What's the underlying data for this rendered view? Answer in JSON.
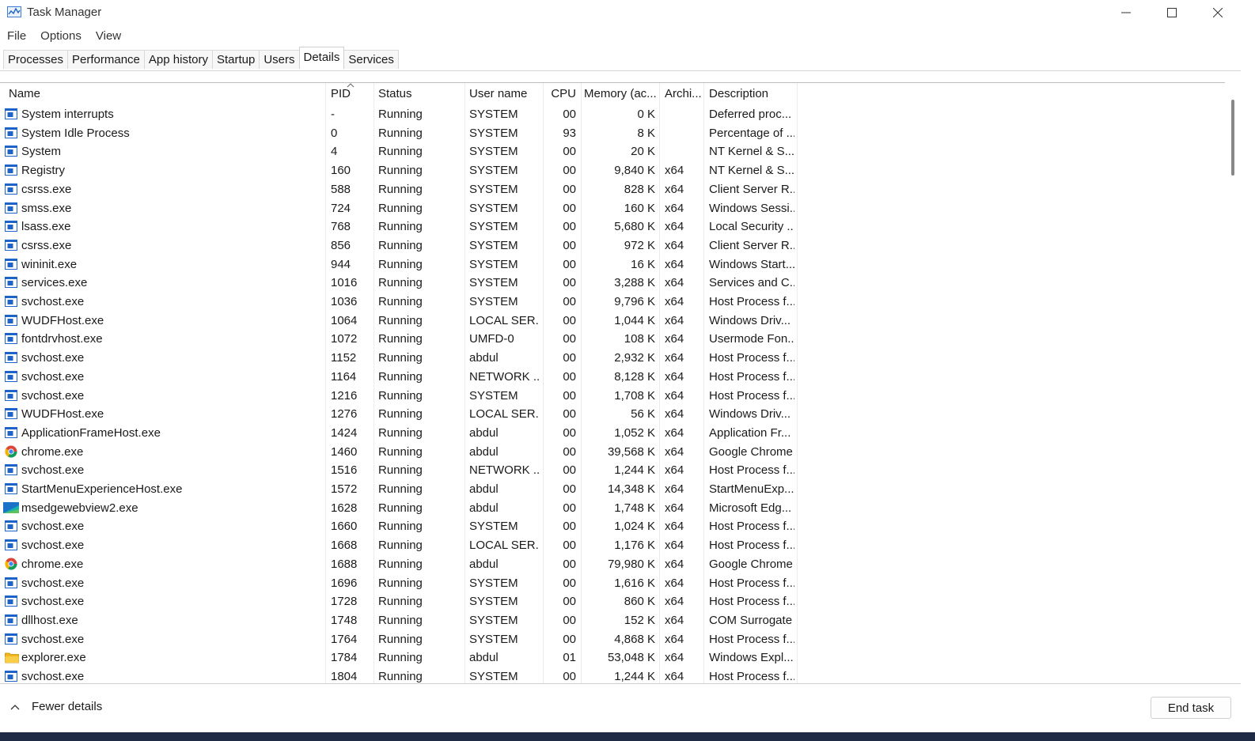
{
  "window": {
    "title": "Task Manager"
  },
  "menu": [
    "File",
    "Options",
    "View"
  ],
  "tabs": [
    {
      "label": "Processes",
      "active": false
    },
    {
      "label": "Performance",
      "active": false
    },
    {
      "label": "App history",
      "active": false
    },
    {
      "label": "Startup",
      "active": false
    },
    {
      "label": "Users",
      "active": false
    },
    {
      "label": "Details",
      "active": true
    },
    {
      "label": "Services",
      "active": false
    }
  ],
  "table": {
    "columns": [
      "Name",
      "PID",
      "Status",
      "User name",
      "CPU",
      "Memory (ac...",
      "Archi...",
      "Description"
    ],
    "sorted_column": "PID",
    "rows": [
      {
        "icon": "window",
        "name": "System interrupts",
        "pid": "-",
        "status": "Running",
        "user": "SYSTEM",
        "cpu": "00",
        "memory": "0 K",
        "arch": "",
        "desc": "Deferred proc..."
      },
      {
        "icon": "window",
        "name": "System Idle Process",
        "pid": "0",
        "status": "Running",
        "user": "SYSTEM",
        "cpu": "93",
        "memory": "8 K",
        "arch": "",
        "desc": "Percentage of ..."
      },
      {
        "icon": "window",
        "name": "System",
        "pid": "4",
        "status": "Running",
        "user": "SYSTEM",
        "cpu": "00",
        "memory": "20 K",
        "arch": "",
        "desc": "NT Kernel & S..."
      },
      {
        "icon": "window",
        "name": "Registry",
        "pid": "160",
        "status": "Running",
        "user": "SYSTEM",
        "cpu": "00",
        "memory": "9,840 K",
        "arch": "x64",
        "desc": "NT Kernel & S..."
      },
      {
        "icon": "window",
        "name": "csrss.exe",
        "pid": "588",
        "status": "Running",
        "user": "SYSTEM",
        "cpu": "00",
        "memory": "828 K",
        "arch": "x64",
        "desc": "Client Server R..."
      },
      {
        "icon": "window",
        "name": "smss.exe",
        "pid": "724",
        "status": "Running",
        "user": "SYSTEM",
        "cpu": "00",
        "memory": "160 K",
        "arch": "x64",
        "desc": "Windows Sessi..."
      },
      {
        "icon": "window",
        "name": "lsass.exe",
        "pid": "768",
        "status": "Running",
        "user": "SYSTEM",
        "cpu": "00",
        "memory": "5,680 K",
        "arch": "x64",
        "desc": "Local Security ..."
      },
      {
        "icon": "window",
        "name": "csrss.exe",
        "pid": "856",
        "status": "Running",
        "user": "SYSTEM",
        "cpu": "00",
        "memory": "972 K",
        "arch": "x64",
        "desc": "Client Server R..."
      },
      {
        "icon": "window",
        "name": "wininit.exe",
        "pid": "944",
        "status": "Running",
        "user": "SYSTEM",
        "cpu": "00",
        "memory": "16 K",
        "arch": "x64",
        "desc": "Windows Start..."
      },
      {
        "icon": "window",
        "name": "services.exe",
        "pid": "1016",
        "status": "Running",
        "user": "SYSTEM",
        "cpu": "00",
        "memory": "3,288 K",
        "arch": "x64",
        "desc": "Services and C..."
      },
      {
        "icon": "window",
        "name": "svchost.exe",
        "pid": "1036",
        "status": "Running",
        "user": "SYSTEM",
        "cpu": "00",
        "memory": "9,796 K",
        "arch": "x64",
        "desc": "Host Process f..."
      },
      {
        "icon": "window",
        "name": "WUDFHost.exe",
        "pid": "1064",
        "status": "Running",
        "user": "LOCAL SER...",
        "cpu": "00",
        "memory": "1,044 K",
        "arch": "x64",
        "desc": "Windows Driv..."
      },
      {
        "icon": "window",
        "name": "fontdrvhost.exe",
        "pid": "1072",
        "status": "Running",
        "user": "UMFD-0",
        "cpu": "00",
        "memory": "108 K",
        "arch": "x64",
        "desc": "Usermode Fon..."
      },
      {
        "icon": "window",
        "name": "svchost.exe",
        "pid": "1152",
        "status": "Running",
        "user": "abdul",
        "cpu": "00",
        "memory": "2,932 K",
        "arch": "x64",
        "desc": "Host Process f..."
      },
      {
        "icon": "window",
        "name": "svchost.exe",
        "pid": "1164",
        "status": "Running",
        "user": "NETWORK ...",
        "cpu": "00",
        "memory": "8,128 K",
        "arch": "x64",
        "desc": "Host Process f..."
      },
      {
        "icon": "window",
        "name": "svchost.exe",
        "pid": "1216",
        "status": "Running",
        "user": "SYSTEM",
        "cpu": "00",
        "memory": "1,708 K",
        "arch": "x64",
        "desc": "Host Process f..."
      },
      {
        "icon": "window",
        "name": "WUDFHost.exe",
        "pid": "1276",
        "status": "Running",
        "user": "LOCAL SER...",
        "cpu": "00",
        "memory": "56 K",
        "arch": "x64",
        "desc": "Windows Driv..."
      },
      {
        "icon": "window",
        "name": "ApplicationFrameHost.exe",
        "pid": "1424",
        "status": "Running",
        "user": "abdul",
        "cpu": "00",
        "memory": "1,052 K",
        "arch": "x64",
        "desc": "Application Fr..."
      },
      {
        "icon": "chrome",
        "name": "chrome.exe",
        "pid": "1460",
        "status": "Running",
        "user": "abdul",
        "cpu": "00",
        "memory": "39,568 K",
        "arch": "x64",
        "desc": "Google Chrome"
      },
      {
        "icon": "window",
        "name": "svchost.exe",
        "pid": "1516",
        "status": "Running",
        "user": "NETWORK ...",
        "cpu": "00",
        "memory": "1,244 K",
        "arch": "x64",
        "desc": "Host Process f..."
      },
      {
        "icon": "window",
        "name": "StartMenuExperienceHost.exe",
        "pid": "1572",
        "status": "Running",
        "user": "abdul",
        "cpu": "00",
        "memory": "14,348 K",
        "arch": "x64",
        "desc": "StartMenuExp..."
      },
      {
        "icon": "edge",
        "name": "msedgewebview2.exe",
        "pid": "1628",
        "status": "Running",
        "user": "abdul",
        "cpu": "00",
        "memory": "1,748 K",
        "arch": "x64",
        "desc": "Microsoft Edg..."
      },
      {
        "icon": "window",
        "name": "svchost.exe",
        "pid": "1660",
        "status": "Running",
        "user": "SYSTEM",
        "cpu": "00",
        "memory": "1,024 K",
        "arch": "x64",
        "desc": "Host Process f..."
      },
      {
        "icon": "window",
        "name": "svchost.exe",
        "pid": "1668",
        "status": "Running",
        "user": "LOCAL SER...",
        "cpu": "00",
        "memory": "1,176 K",
        "arch": "x64",
        "desc": "Host Process f..."
      },
      {
        "icon": "chrome",
        "name": "chrome.exe",
        "pid": "1688",
        "status": "Running",
        "user": "abdul",
        "cpu": "00",
        "memory": "79,980 K",
        "arch": "x64",
        "desc": "Google Chrome"
      },
      {
        "icon": "window",
        "name": "svchost.exe",
        "pid": "1696",
        "status": "Running",
        "user": "SYSTEM",
        "cpu": "00",
        "memory": "1,616 K",
        "arch": "x64",
        "desc": "Host Process f..."
      },
      {
        "icon": "window",
        "name": "svchost.exe",
        "pid": "1728",
        "status": "Running",
        "user": "SYSTEM",
        "cpu": "00",
        "memory": "860 K",
        "arch": "x64",
        "desc": "Host Process f..."
      },
      {
        "icon": "window",
        "name": "dllhost.exe",
        "pid": "1748",
        "status": "Running",
        "user": "SYSTEM",
        "cpu": "00",
        "memory": "152 K",
        "arch": "x64",
        "desc": "COM Surrogate"
      },
      {
        "icon": "window",
        "name": "svchost.exe",
        "pid": "1764",
        "status": "Running",
        "user": "SYSTEM",
        "cpu": "00",
        "memory": "4,868 K",
        "arch": "x64",
        "desc": "Host Process f..."
      },
      {
        "icon": "folder",
        "name": "explorer.exe",
        "pid": "1784",
        "status": "Running",
        "user": "abdul",
        "cpu": "01",
        "memory": "53,048 K",
        "arch": "x64",
        "desc": "Windows Expl..."
      },
      {
        "icon": "window",
        "name": "svchost.exe",
        "pid": "1804",
        "status": "Running",
        "user": "SYSTEM",
        "cpu": "00",
        "memory": "1,244 K",
        "arch": "x64",
        "desc": "Host Process f..."
      }
    ]
  },
  "footer": {
    "fewer_details": "Fewer details",
    "end_task": "End task"
  },
  "colors": {
    "desktop": "#1f2a44",
    "process_icon": "#1e63c8"
  }
}
